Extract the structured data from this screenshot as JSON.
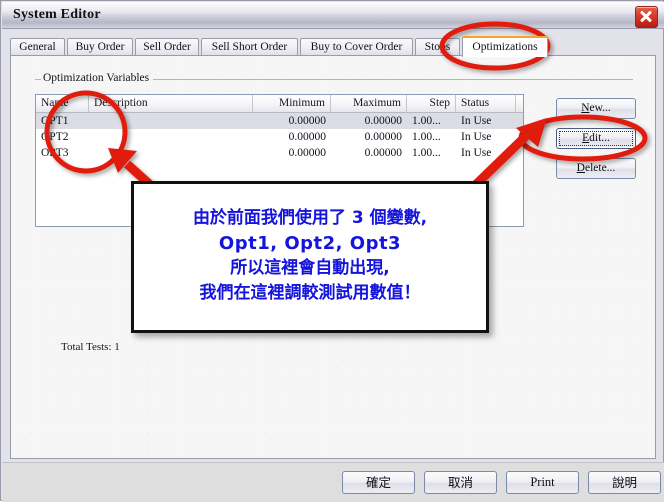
{
  "window": {
    "title": "System Editor",
    "close_icon": "close-icon"
  },
  "tabs": [
    {
      "label": "General",
      "active": false
    },
    {
      "label": "Buy Order",
      "active": false
    },
    {
      "label": "Sell Order",
      "active": false
    },
    {
      "label": "Sell Short Order",
      "active": false
    },
    {
      "label": "Buy to Cover Order",
      "active": false
    },
    {
      "label": "Stops",
      "active": false
    },
    {
      "label": "Optimizations",
      "active": true
    }
  ],
  "groupbox": {
    "label": "Optimization Variables"
  },
  "table": {
    "columns": [
      "Name",
      "Description",
      "Minimum",
      "Maximum",
      "Step",
      "Status"
    ],
    "rows": [
      {
        "name": "OPT1",
        "description": "",
        "minimum": "0.00000",
        "maximum": "0.00000",
        "step": "1.00...",
        "status": "In Use",
        "selected": true
      },
      {
        "name": "OPT2",
        "description": "",
        "minimum": "0.00000",
        "maximum": "0.00000",
        "step": "1.00...",
        "status": "In Use",
        "selected": false
      },
      {
        "name": "OPT3",
        "description": "",
        "minimum": "0.00000",
        "maximum": "0.00000",
        "step": "1.00...",
        "status": "In Use",
        "selected": false
      }
    ]
  },
  "status": {
    "total_tests": "Total Tests: 1"
  },
  "side_buttons": {
    "new": {
      "accel": "N",
      "rest": "ew..."
    },
    "edit": {
      "accel": "E",
      "rest": "dit..."
    },
    "delete": {
      "accel": "D",
      "rest": "elete..."
    }
  },
  "bottom_buttons": [
    {
      "label": "確定",
      "cjk": true
    },
    {
      "label": "取消",
      "cjk": true
    },
    {
      "label": "Print",
      "cjk": false
    },
    {
      "label": "說明",
      "cjk": true
    }
  ],
  "annotation": {
    "line1": "由於前面我們使用了 3 個變數,",
    "line2": "Opt1, Opt2, Opt3",
    "line3": "所以這裡會自動出現,",
    "line4": "我們在這裡調較測試用數值！",
    "text_color": "#1414dd",
    "highlight_color": "#e01b10"
  }
}
